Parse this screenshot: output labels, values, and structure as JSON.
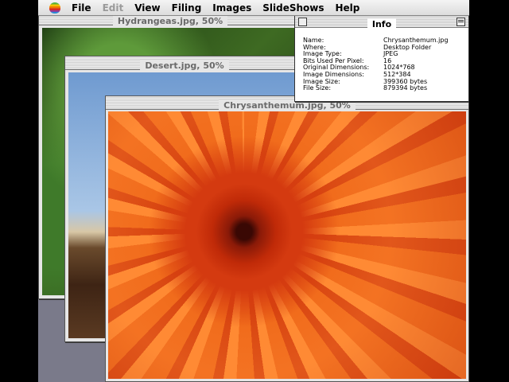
{
  "menubar": {
    "items": [
      {
        "label": "File",
        "enabled": true
      },
      {
        "label": "Edit",
        "enabled": false
      },
      {
        "label": "View",
        "enabled": true
      },
      {
        "label": "Filing",
        "enabled": true
      },
      {
        "label": "Images",
        "enabled": true
      },
      {
        "label": "SlideShows",
        "enabled": true
      },
      {
        "label": "Help",
        "enabled": true
      }
    ],
    "apple_icon": "apple-logo-icon"
  },
  "windows": {
    "hydrangeas": {
      "title": "Hydrangeas.jpg, 50%"
    },
    "desert": {
      "title": "Desert.jpg, 50%"
    },
    "chrysanthemum": {
      "title": "Chrysanthemum.jpg, 50%"
    }
  },
  "info": {
    "title": "Info",
    "rows": [
      {
        "key": "Name:",
        "value": "Chrysanthemum.jpg"
      },
      {
        "key": "Where:",
        "value": "Desktop Folder"
      },
      {
        "key": "Image Type:",
        "value": "JPEG"
      },
      {
        "key": "Bits Used Per Pixel:",
        "value": "16"
      },
      {
        "key": "Original Dimensions:",
        "value": "1024*768"
      },
      {
        "key": "Image Dimensions:",
        "value": "512*384"
      },
      {
        "key": "Image Size:",
        "value": "399360 bytes"
      },
      {
        "key": "File Size:",
        "value": "879394 bytes"
      }
    ]
  }
}
